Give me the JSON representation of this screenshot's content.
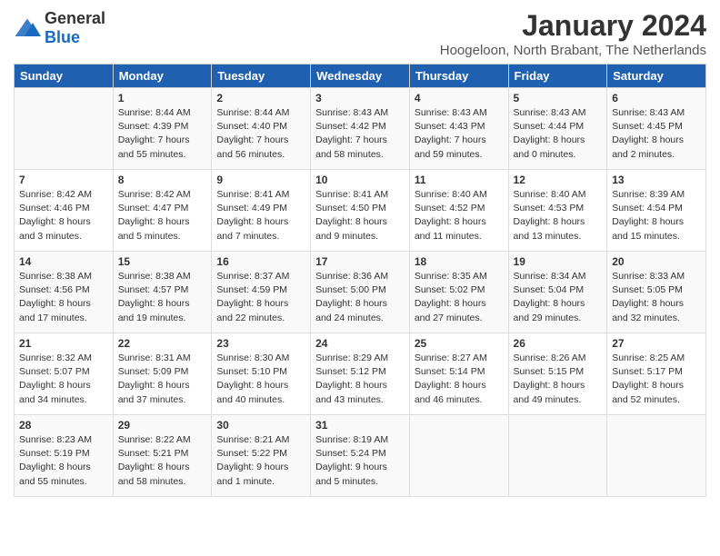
{
  "header": {
    "logo_general": "General",
    "logo_blue": "Blue",
    "title": "January 2024",
    "subtitle": "Hoogeloon, North Brabant, The Netherlands"
  },
  "weekdays": [
    "Sunday",
    "Monday",
    "Tuesday",
    "Wednesday",
    "Thursday",
    "Friday",
    "Saturday"
  ],
  "weeks": [
    [
      {
        "day": "",
        "sunrise": "",
        "sunset": "",
        "daylight": ""
      },
      {
        "day": "1",
        "sunrise": "Sunrise: 8:44 AM",
        "sunset": "Sunset: 4:39 PM",
        "daylight": "Daylight: 7 hours and 55 minutes."
      },
      {
        "day": "2",
        "sunrise": "Sunrise: 8:44 AM",
        "sunset": "Sunset: 4:40 PM",
        "daylight": "Daylight: 7 hours and 56 minutes."
      },
      {
        "day": "3",
        "sunrise": "Sunrise: 8:43 AM",
        "sunset": "Sunset: 4:42 PM",
        "daylight": "Daylight: 7 hours and 58 minutes."
      },
      {
        "day": "4",
        "sunrise": "Sunrise: 8:43 AM",
        "sunset": "Sunset: 4:43 PM",
        "daylight": "Daylight: 7 hours and 59 minutes."
      },
      {
        "day": "5",
        "sunrise": "Sunrise: 8:43 AM",
        "sunset": "Sunset: 4:44 PM",
        "daylight": "Daylight: 8 hours and 0 minutes."
      },
      {
        "day": "6",
        "sunrise": "Sunrise: 8:43 AM",
        "sunset": "Sunset: 4:45 PM",
        "daylight": "Daylight: 8 hours and 2 minutes."
      }
    ],
    [
      {
        "day": "7",
        "sunrise": "Sunrise: 8:42 AM",
        "sunset": "Sunset: 4:46 PM",
        "daylight": "Daylight: 8 hours and 3 minutes."
      },
      {
        "day": "8",
        "sunrise": "Sunrise: 8:42 AM",
        "sunset": "Sunset: 4:47 PM",
        "daylight": "Daylight: 8 hours and 5 minutes."
      },
      {
        "day": "9",
        "sunrise": "Sunrise: 8:41 AM",
        "sunset": "Sunset: 4:49 PM",
        "daylight": "Daylight: 8 hours and 7 minutes."
      },
      {
        "day": "10",
        "sunrise": "Sunrise: 8:41 AM",
        "sunset": "Sunset: 4:50 PM",
        "daylight": "Daylight: 8 hours and 9 minutes."
      },
      {
        "day": "11",
        "sunrise": "Sunrise: 8:40 AM",
        "sunset": "Sunset: 4:52 PM",
        "daylight": "Daylight: 8 hours and 11 minutes."
      },
      {
        "day": "12",
        "sunrise": "Sunrise: 8:40 AM",
        "sunset": "Sunset: 4:53 PM",
        "daylight": "Daylight: 8 hours and 13 minutes."
      },
      {
        "day": "13",
        "sunrise": "Sunrise: 8:39 AM",
        "sunset": "Sunset: 4:54 PM",
        "daylight": "Daylight: 8 hours and 15 minutes."
      }
    ],
    [
      {
        "day": "14",
        "sunrise": "Sunrise: 8:38 AM",
        "sunset": "Sunset: 4:56 PM",
        "daylight": "Daylight: 8 hours and 17 minutes."
      },
      {
        "day": "15",
        "sunrise": "Sunrise: 8:38 AM",
        "sunset": "Sunset: 4:57 PM",
        "daylight": "Daylight: 8 hours and 19 minutes."
      },
      {
        "day": "16",
        "sunrise": "Sunrise: 8:37 AM",
        "sunset": "Sunset: 4:59 PM",
        "daylight": "Daylight: 8 hours and 22 minutes."
      },
      {
        "day": "17",
        "sunrise": "Sunrise: 8:36 AM",
        "sunset": "Sunset: 5:00 PM",
        "daylight": "Daylight: 8 hours and 24 minutes."
      },
      {
        "day": "18",
        "sunrise": "Sunrise: 8:35 AM",
        "sunset": "Sunset: 5:02 PM",
        "daylight": "Daylight: 8 hours and 27 minutes."
      },
      {
        "day": "19",
        "sunrise": "Sunrise: 8:34 AM",
        "sunset": "Sunset: 5:04 PM",
        "daylight": "Daylight: 8 hours and 29 minutes."
      },
      {
        "day": "20",
        "sunrise": "Sunrise: 8:33 AM",
        "sunset": "Sunset: 5:05 PM",
        "daylight": "Daylight: 8 hours and 32 minutes."
      }
    ],
    [
      {
        "day": "21",
        "sunrise": "Sunrise: 8:32 AM",
        "sunset": "Sunset: 5:07 PM",
        "daylight": "Daylight: 8 hours and 34 minutes."
      },
      {
        "day": "22",
        "sunrise": "Sunrise: 8:31 AM",
        "sunset": "Sunset: 5:09 PM",
        "daylight": "Daylight: 8 hours and 37 minutes."
      },
      {
        "day": "23",
        "sunrise": "Sunrise: 8:30 AM",
        "sunset": "Sunset: 5:10 PM",
        "daylight": "Daylight: 8 hours and 40 minutes."
      },
      {
        "day": "24",
        "sunrise": "Sunrise: 8:29 AM",
        "sunset": "Sunset: 5:12 PM",
        "daylight": "Daylight: 8 hours and 43 minutes."
      },
      {
        "day": "25",
        "sunrise": "Sunrise: 8:27 AM",
        "sunset": "Sunset: 5:14 PM",
        "daylight": "Daylight: 8 hours and 46 minutes."
      },
      {
        "day": "26",
        "sunrise": "Sunrise: 8:26 AM",
        "sunset": "Sunset: 5:15 PM",
        "daylight": "Daylight: 8 hours and 49 minutes."
      },
      {
        "day": "27",
        "sunrise": "Sunrise: 8:25 AM",
        "sunset": "Sunset: 5:17 PM",
        "daylight": "Daylight: 8 hours and 52 minutes."
      }
    ],
    [
      {
        "day": "28",
        "sunrise": "Sunrise: 8:23 AM",
        "sunset": "Sunset: 5:19 PM",
        "daylight": "Daylight: 8 hours and 55 minutes."
      },
      {
        "day": "29",
        "sunrise": "Sunrise: 8:22 AM",
        "sunset": "Sunset: 5:21 PM",
        "daylight": "Daylight: 8 hours and 58 minutes."
      },
      {
        "day": "30",
        "sunrise": "Sunrise: 8:21 AM",
        "sunset": "Sunset: 5:22 PM",
        "daylight": "Daylight: 9 hours and 1 minute."
      },
      {
        "day": "31",
        "sunrise": "Sunrise: 8:19 AM",
        "sunset": "Sunset: 5:24 PM",
        "daylight": "Daylight: 9 hours and 5 minutes."
      },
      {
        "day": "",
        "sunrise": "",
        "sunset": "",
        "daylight": ""
      },
      {
        "day": "",
        "sunrise": "",
        "sunset": "",
        "daylight": ""
      },
      {
        "day": "",
        "sunrise": "",
        "sunset": "",
        "daylight": ""
      }
    ]
  ]
}
